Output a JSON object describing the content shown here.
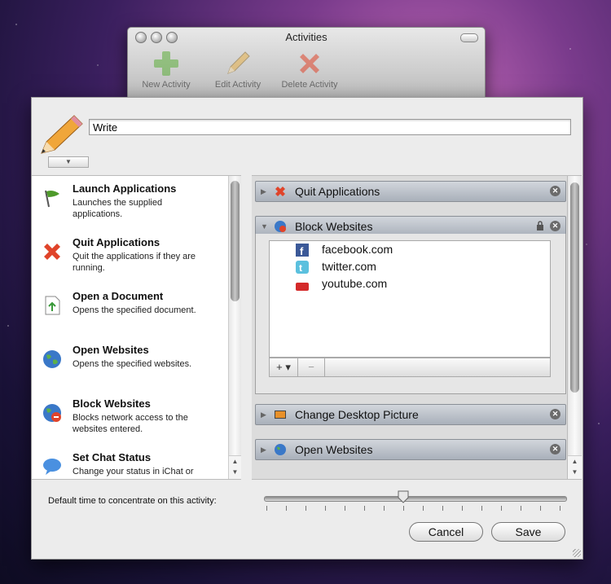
{
  "window": {
    "title": "Activities"
  },
  "toolbar": {
    "buttons": [
      {
        "label": "New Activity",
        "icon": "plus-icon"
      },
      {
        "label": "Edit Activity",
        "icon": "pencil-icon"
      },
      {
        "label": "Delete Activity",
        "icon": "x-icon"
      }
    ]
  },
  "activity": {
    "name": "Write"
  },
  "actions_list": [
    {
      "title": "Launch Applications",
      "desc": "Launches the supplied applications.",
      "icon": "flag-icon"
    },
    {
      "title": "Quit Applications",
      "desc": "Quit the applications if they are running.",
      "icon": "quit-icon"
    },
    {
      "title": "Open a Document",
      "desc": "Opens the specified document.",
      "icon": "document-icon"
    },
    {
      "title": "Open Websites",
      "desc": "Opens the specified websites.",
      "icon": "globe-icon"
    },
    {
      "title": "Block Websites",
      "desc": "Blocks network access to the websites entered.",
      "icon": "block-globe-icon"
    },
    {
      "title": "Set Chat Status",
      "desc": "Change your status in iChat or",
      "icon": "chat-icon"
    }
  ],
  "selected_actions": [
    {
      "label": "Quit Applications"
    },
    {
      "label": "Block Websites"
    },
    {
      "label": "Change Desktop Picture"
    },
    {
      "label": "Open Websites"
    }
  ],
  "blocked_sites": [
    "facebook.com",
    "twitter.com",
    "youtube.com"
  ],
  "site_editor": {
    "add": "+ ▾",
    "remove": "−"
  },
  "slider": {
    "label": "Default time to concentrate on this activity:",
    "value_fraction": 0.45
  },
  "buttons": {
    "cancel": "Cancel",
    "save": "Save"
  },
  "colors": {
    "close_badge": "#6b6b6b",
    "bar_top": "#d2d6dc",
    "bar_bottom": "#a9b0ba"
  }
}
